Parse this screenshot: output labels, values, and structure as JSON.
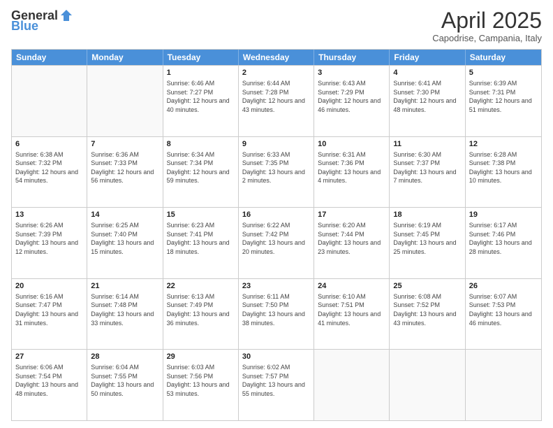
{
  "logo": {
    "general": "General",
    "blue": "Blue"
  },
  "title": {
    "month": "April 2025",
    "location": "Capodrise, Campania, Italy"
  },
  "days": [
    "Sunday",
    "Monday",
    "Tuesday",
    "Wednesday",
    "Thursday",
    "Friday",
    "Saturday"
  ],
  "weeks": [
    [
      {
        "day": "",
        "info": ""
      },
      {
        "day": "",
        "info": ""
      },
      {
        "day": "1",
        "info": "Sunrise: 6:46 AM\nSunset: 7:27 PM\nDaylight: 12 hours and 40 minutes."
      },
      {
        "day": "2",
        "info": "Sunrise: 6:44 AM\nSunset: 7:28 PM\nDaylight: 12 hours and 43 minutes."
      },
      {
        "day": "3",
        "info": "Sunrise: 6:43 AM\nSunset: 7:29 PM\nDaylight: 12 hours and 46 minutes."
      },
      {
        "day": "4",
        "info": "Sunrise: 6:41 AM\nSunset: 7:30 PM\nDaylight: 12 hours and 48 minutes."
      },
      {
        "day": "5",
        "info": "Sunrise: 6:39 AM\nSunset: 7:31 PM\nDaylight: 12 hours and 51 minutes."
      }
    ],
    [
      {
        "day": "6",
        "info": "Sunrise: 6:38 AM\nSunset: 7:32 PM\nDaylight: 12 hours and 54 minutes."
      },
      {
        "day": "7",
        "info": "Sunrise: 6:36 AM\nSunset: 7:33 PM\nDaylight: 12 hours and 56 minutes."
      },
      {
        "day": "8",
        "info": "Sunrise: 6:34 AM\nSunset: 7:34 PM\nDaylight: 12 hours and 59 minutes."
      },
      {
        "day": "9",
        "info": "Sunrise: 6:33 AM\nSunset: 7:35 PM\nDaylight: 13 hours and 2 minutes."
      },
      {
        "day": "10",
        "info": "Sunrise: 6:31 AM\nSunset: 7:36 PM\nDaylight: 13 hours and 4 minutes."
      },
      {
        "day": "11",
        "info": "Sunrise: 6:30 AM\nSunset: 7:37 PM\nDaylight: 13 hours and 7 minutes."
      },
      {
        "day": "12",
        "info": "Sunrise: 6:28 AM\nSunset: 7:38 PM\nDaylight: 13 hours and 10 minutes."
      }
    ],
    [
      {
        "day": "13",
        "info": "Sunrise: 6:26 AM\nSunset: 7:39 PM\nDaylight: 13 hours and 12 minutes."
      },
      {
        "day": "14",
        "info": "Sunrise: 6:25 AM\nSunset: 7:40 PM\nDaylight: 13 hours and 15 minutes."
      },
      {
        "day": "15",
        "info": "Sunrise: 6:23 AM\nSunset: 7:41 PM\nDaylight: 13 hours and 18 minutes."
      },
      {
        "day": "16",
        "info": "Sunrise: 6:22 AM\nSunset: 7:42 PM\nDaylight: 13 hours and 20 minutes."
      },
      {
        "day": "17",
        "info": "Sunrise: 6:20 AM\nSunset: 7:44 PM\nDaylight: 13 hours and 23 minutes."
      },
      {
        "day": "18",
        "info": "Sunrise: 6:19 AM\nSunset: 7:45 PM\nDaylight: 13 hours and 25 minutes."
      },
      {
        "day": "19",
        "info": "Sunrise: 6:17 AM\nSunset: 7:46 PM\nDaylight: 13 hours and 28 minutes."
      }
    ],
    [
      {
        "day": "20",
        "info": "Sunrise: 6:16 AM\nSunset: 7:47 PM\nDaylight: 13 hours and 31 minutes."
      },
      {
        "day": "21",
        "info": "Sunrise: 6:14 AM\nSunset: 7:48 PM\nDaylight: 13 hours and 33 minutes."
      },
      {
        "day": "22",
        "info": "Sunrise: 6:13 AM\nSunset: 7:49 PM\nDaylight: 13 hours and 36 minutes."
      },
      {
        "day": "23",
        "info": "Sunrise: 6:11 AM\nSunset: 7:50 PM\nDaylight: 13 hours and 38 minutes."
      },
      {
        "day": "24",
        "info": "Sunrise: 6:10 AM\nSunset: 7:51 PM\nDaylight: 13 hours and 41 minutes."
      },
      {
        "day": "25",
        "info": "Sunrise: 6:08 AM\nSunset: 7:52 PM\nDaylight: 13 hours and 43 minutes."
      },
      {
        "day": "26",
        "info": "Sunrise: 6:07 AM\nSunset: 7:53 PM\nDaylight: 13 hours and 46 minutes."
      }
    ],
    [
      {
        "day": "27",
        "info": "Sunrise: 6:06 AM\nSunset: 7:54 PM\nDaylight: 13 hours and 48 minutes."
      },
      {
        "day": "28",
        "info": "Sunrise: 6:04 AM\nSunset: 7:55 PM\nDaylight: 13 hours and 50 minutes."
      },
      {
        "day": "29",
        "info": "Sunrise: 6:03 AM\nSunset: 7:56 PM\nDaylight: 13 hours and 53 minutes."
      },
      {
        "day": "30",
        "info": "Sunrise: 6:02 AM\nSunset: 7:57 PM\nDaylight: 13 hours and 55 minutes."
      },
      {
        "day": "",
        "info": ""
      },
      {
        "day": "",
        "info": ""
      },
      {
        "day": "",
        "info": ""
      }
    ]
  ]
}
